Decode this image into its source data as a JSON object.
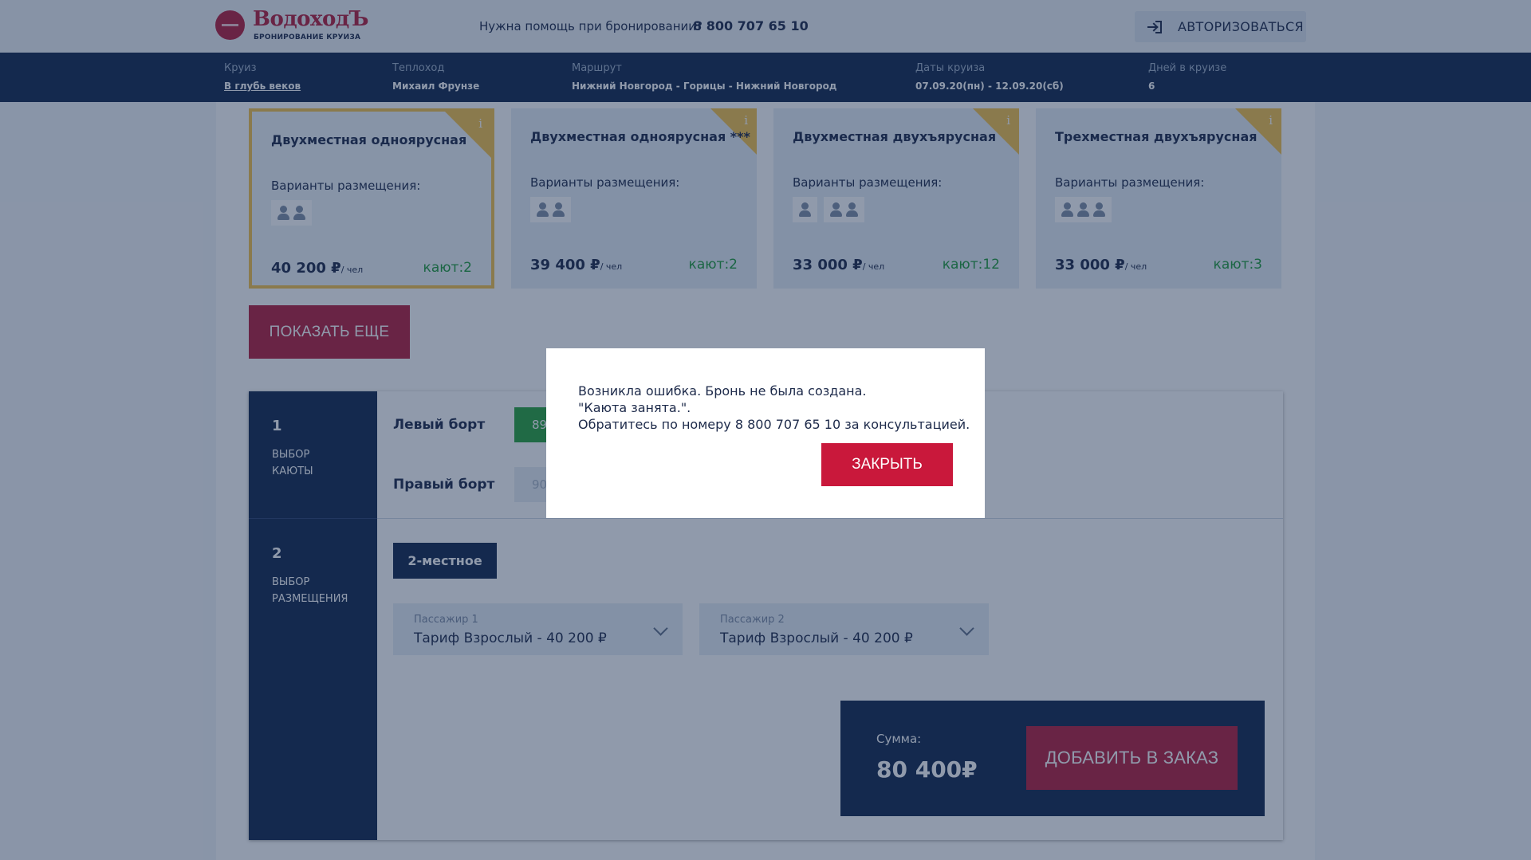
{
  "header": {
    "logo_name": "ВодоходЪ",
    "logo_sub": "БРОНИРОВАНИЕ КРУИЗА",
    "help_text": "Нужна помощь при бронировании?",
    "phone": "8 800 707 65 10",
    "auth_label": "АВТОРИЗОВАТЬСЯ"
  },
  "infobar": {
    "cruise": {
      "label": "Круиз",
      "value": "В глубь веков"
    },
    "ship": {
      "label": "Теплоход",
      "value": "Михаил Фрунзе"
    },
    "route": {
      "label": "Маршрут",
      "value": "Нижний Новгород - Горицы - Нижний Новгород"
    },
    "dates": {
      "label": "Даты круиза",
      "value": "07.09.20(пн) - 12.09.20(сб)"
    },
    "days": {
      "label": "Дней в круизе",
      "value": "6"
    }
  },
  "cards": [
    {
      "title": "Двухместная одноярусная",
      "sub": "Варианты размещения:",
      "price": "40 200 ₽",
      "per": "/ чел",
      "count": "кают:2",
      "selected": true
    },
    {
      "title": "Двухместная одноярусная ***",
      "sub": "Варианты размещения:",
      "price": "39 400 ₽",
      "per": "/ чел",
      "count": "кают:2",
      "selected": false
    },
    {
      "title": "Двухместная двухъярусная",
      "sub": "Варианты размещения:",
      "price": "33 000 ₽",
      "per": "/ чел",
      "count": "кают:12",
      "selected": false
    },
    {
      "title": "Трехместная двухъярусная",
      "sub": "Варианты размещения:",
      "price": "33 000 ₽",
      "per": "/ чел",
      "count": "кают:3",
      "selected": false
    }
  ],
  "card_info_icon": "i",
  "show_more": "ПОКАЗАТЬ ЕЩЕ",
  "steps": {
    "step1": {
      "num": "1",
      "line1": "ВЫБОР",
      "line2": "КАЮТЫ"
    },
    "step2": {
      "num": "2",
      "line1": "ВЫБОР",
      "line2": "РАЗМЕЩЕНИЯ"
    }
  },
  "cabin": {
    "left_label": "Левый борт",
    "right_label": "Правый борт",
    "left_chip": "89",
    "right_chip": "90"
  },
  "placement_btn": "2-местное",
  "passengers": [
    {
      "label": "Пассажир 1",
      "value": "Тариф Взрослый - 40 200 ₽"
    },
    {
      "label": "Пассажир 2",
      "value": "Тариф Взрослый - 40 200 ₽"
    }
  ],
  "sum": {
    "label": "Сумма:",
    "value": "80 400₽"
  },
  "add_btn": "ДОБАВИТЬ В ЗАКАЗ",
  "modal": {
    "line1": "Возникла ошибка. Бронь не была создана.",
    "line2": "\"Каюта занята.\".",
    "line3": "Обратитесь по номеру 8 800 707 65 10 за консультацией.",
    "close": "ЗАКРЫТЬ"
  },
  "colors": {
    "navy": "#13284e",
    "brand_red": "#b51d3c",
    "accent_gold": "#f4c24c",
    "green": "#2aa43c"
  }
}
